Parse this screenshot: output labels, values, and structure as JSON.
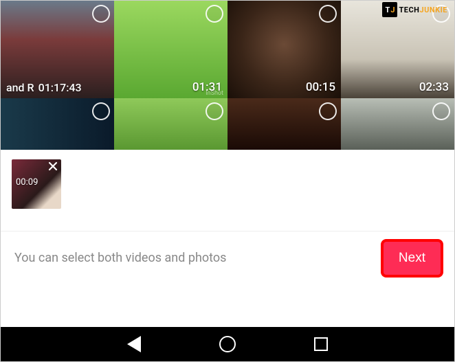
{
  "watermark": {
    "brand_a": "TECH",
    "brand_b": "JUNKIE"
  },
  "gallery": {
    "row1": [
      {
        "duration": "01:17:43",
        "overlay_text": "and R"
      },
      {
        "duration": "01:31",
        "badge": "InShot"
      },
      {
        "duration": "00:15"
      },
      {
        "duration": "02:33"
      }
    ]
  },
  "selected": {
    "items": [
      {
        "duration": "00:09"
      }
    ]
  },
  "hint_text": "You can select both videos and photos",
  "next_label": "Next"
}
